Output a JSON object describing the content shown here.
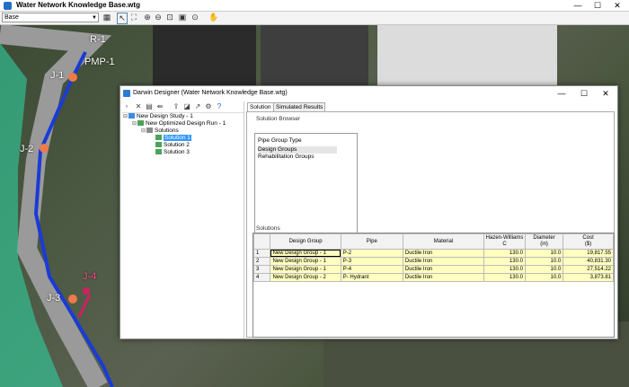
{
  "window": {
    "title": "Water Network Knowledge Base.wtg",
    "min": "—",
    "max": "☐",
    "close": "✕"
  },
  "toolbar": {
    "scenario": "Base"
  },
  "map": {
    "labels": [
      {
        "text": "R-1"
      },
      {
        "text": "PMP-1"
      },
      {
        "text": "J-1"
      },
      {
        "text": "J-2"
      },
      {
        "text": "J-3"
      },
      {
        "text": "J-4"
      }
    ]
  },
  "dialog": {
    "title": "Darwin Designer (Water Network Knowledge Base.wtg)",
    "tree": {
      "study": "New Design Study - 1",
      "run": "New Optimized Design Run - 1",
      "solutions": "Solutions",
      "items": [
        "Solution 1",
        "Solution 2",
        "Solution 3"
      ]
    },
    "tabs": [
      "Solution",
      "Simulated Results"
    ],
    "browser": {
      "label": "Solution Browser",
      "header": "Pipe Group Type",
      "rows": [
        "Design Groups",
        "Rehabilitation Groups"
      ]
    },
    "solutions": {
      "label": "Solutions",
      "columns": [
        "Design Group",
        "Pipe",
        "Material",
        "Hazen-Williams\nC",
        "Diameter\n(in)",
        "Cost\n($)"
      ],
      "rows": [
        {
          "id": "1",
          "group": "New Design Group - 1",
          "pipe": "P-2",
          "material": "Ductile Iron",
          "c": "130.0",
          "dia": "10.0",
          "cost": "19,817.55"
        },
        {
          "id": "2",
          "group": "New Design Group - 1",
          "pipe": "P-3",
          "material": "Ductile Iron",
          "c": "130.0",
          "dia": "10.0",
          "cost": "40,831.30"
        },
        {
          "id": "3",
          "group": "New Design Group - 1",
          "pipe": "P-4",
          "material": "Ductile Iron",
          "c": "130.0",
          "dia": "10.0",
          "cost": "27,514.22"
        },
        {
          "id": "4",
          "group": "New Design Group - 2",
          "pipe": "P- Hydrant",
          "material": "Ductile Iron",
          "c": "130.0",
          "dia": "10.0",
          "cost": "3,873.81"
        }
      ]
    }
  }
}
